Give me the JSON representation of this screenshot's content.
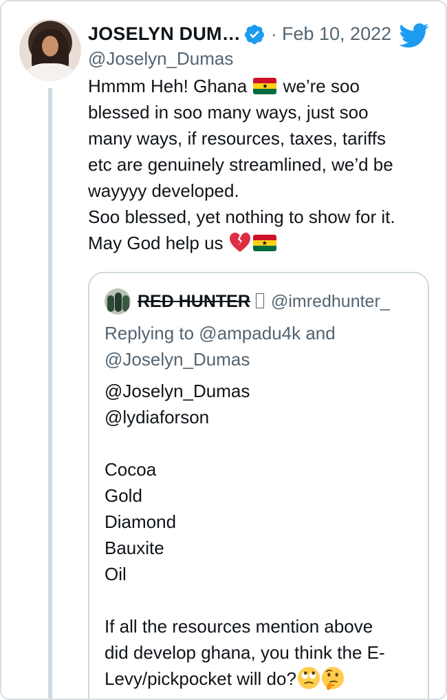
{
  "tweet": {
    "author_name": "JOSELYN DUM…",
    "handle": "@Joselyn_Dumas",
    "separator": "·",
    "date": "Feb 10, 2022",
    "lines": [
      {
        "before": "Hmmm Heh! Ghana ",
        "after": " we’re soo"
      },
      "blessed in soo many ways, just soo",
      "many ways, if resources, taxes, tariffs",
      "etc are genuinely streamlined, we’d be",
      "wayyyy developed.",
      "Soo blessed, yet nothing to show for it.",
      {
        "before": "May God help us "
      }
    ],
    "icons": [
      "verified-badge-icon",
      "twitter-bird-icon",
      "ghana-flag-icon",
      "broken-heart-icon"
    ]
  },
  "quote": {
    "author_name": "RED HUNTER",
    "handle": "@imredhunter_",
    "reply_lines": [
      "Replying to @ampadu4k and",
      "@Joselyn_Dumas"
    ],
    "body_lines": [
      "@Joselyn_Dumas",
      "@lydiaforson",
      "",
      "Cocoa",
      "Gold",
      "Diamond",
      "Bauxite",
      "Oil",
      "",
      "If all the resources mention above",
      "did develop ghana, you think the E-",
      "Levy/pickpocket will do?"
    ],
    "icons": [
      "eye-roll-emoji-icon",
      "thinking-face-emoji-icon"
    ]
  },
  "colors": {
    "text": "#0f1419",
    "secondary": "#536471",
    "twitter_blue": "#1d9bf0",
    "border": "#cfd9de"
  }
}
